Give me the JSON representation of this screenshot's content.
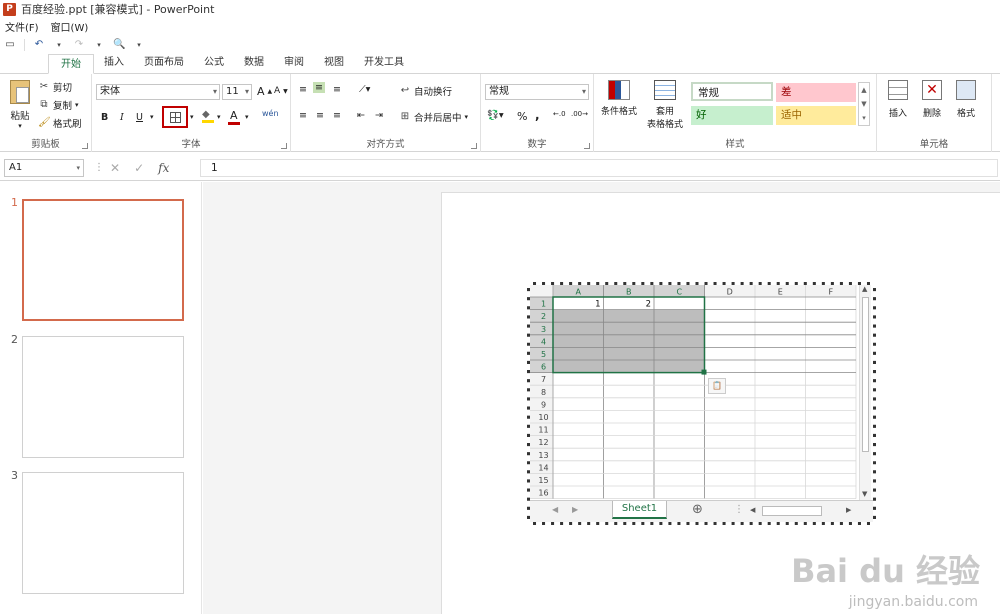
{
  "window": {
    "title": "百度经验.ppt [兼容模式] - PowerPoint",
    "app_letter": "P"
  },
  "menu": {
    "file": "文件(F)",
    "window": "窗口(W)"
  },
  "tabs": [
    {
      "label": "开始"
    },
    {
      "label": "插入"
    },
    {
      "label": "页面布局"
    },
    {
      "label": "公式"
    },
    {
      "label": "数据"
    },
    {
      "label": "审阅"
    },
    {
      "label": "视图"
    },
    {
      "label": "开发工具"
    }
  ],
  "ribbon": {
    "clipboard": {
      "label": "剪贴板",
      "paste": "粘贴",
      "cut": "剪切",
      "copy": "复制",
      "format_painter": "格式刷"
    },
    "font": {
      "label": "字体",
      "name": "宋体",
      "size": "11",
      "bold": "B",
      "italic": "I",
      "underline": "U",
      "font_color_letter": "A",
      "phonetic": "wén"
    },
    "alignment": {
      "label": "对齐方式",
      "wrap": "自动换行",
      "merge": "合并后居中"
    },
    "number": {
      "label": "数字",
      "format": "常规",
      "percent": "%",
      "comma": ","
    },
    "styles": {
      "label": "样式",
      "cond_format": "条件格式",
      "table_format_1": "套用",
      "table_format_2": "表格格式",
      "normal": "常规",
      "bad": "差",
      "good": "好",
      "neutral": "适中"
    },
    "cells": {
      "label": "单元格",
      "insert": "插入",
      "delete": "删除",
      "format": "格式"
    }
  },
  "formula_bar": {
    "name_box": "A1",
    "fx": "fx",
    "value": "1"
  },
  "slides": [
    {
      "num": "1"
    },
    {
      "num": "2"
    },
    {
      "num": "3"
    }
  ],
  "spreadsheet": {
    "columns": [
      "A",
      "B",
      "C",
      "D",
      "E",
      "F"
    ],
    "rows": [
      "1",
      "2",
      "3",
      "4",
      "5",
      "6",
      "7",
      "8",
      "9",
      "10",
      "11",
      "12",
      "13",
      "14",
      "15",
      "16"
    ],
    "cells": {
      "A1": "1",
      "B1": "2"
    },
    "sheet_tab": "Sheet1"
  },
  "watermark": {
    "brand": "Bai du 经验",
    "url": "jingyan.baidu.com"
  },
  "colors": {
    "accent_green": "#217346",
    "slide_active_border": "#d36a4c",
    "style_bad_bg": "#ffc7ce",
    "style_good_bg": "#c6efce",
    "style_neutral_bg": "#ffeb9c"
  }
}
